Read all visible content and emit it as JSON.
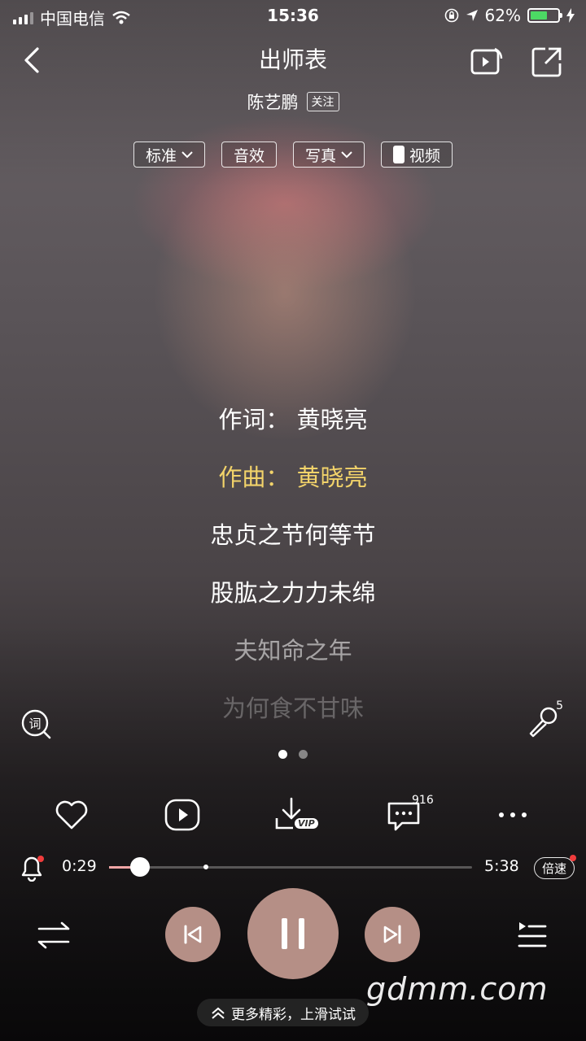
{
  "status_bar": {
    "carrier": "中国电信",
    "time": "15:36",
    "battery_text": "62%",
    "battery_level": 0.62
  },
  "header": {
    "title": "出师表",
    "artist": "陈艺鹏",
    "follow_label": "关注"
  },
  "chips": [
    {
      "label": "标准",
      "has_arrow": true
    },
    {
      "label": "音效",
      "has_arrow": false
    },
    {
      "label": "写真",
      "has_arrow": true
    },
    {
      "label": "视频",
      "has_arrow": false
    }
  ],
  "lyrics": [
    {
      "text": "作词： 黄晓亮",
      "style": "white"
    },
    {
      "text": "作曲： 黄晓亮",
      "style": "gold"
    },
    {
      "text": "忠贞之节何等节",
      "style": "white"
    },
    {
      "text": "股肱之力力未绵",
      "style": "white"
    },
    {
      "text": "夫知命之年",
      "style": "dim"
    },
    {
      "text": "为何食不甘味",
      "style": "dimmer"
    }
  ],
  "mic_count": "5",
  "actions": {
    "comment_count": "916",
    "download_badge": "VIP"
  },
  "player": {
    "current_time": "0:29",
    "total_time": "5:38",
    "progress": 0.086,
    "buffered": 0.26,
    "speed_label": "倍速"
  },
  "watermark": "gdmm.com",
  "bottom_hint": "更多精彩，上滑试试",
  "colors": {
    "accent_gold": "#f2d36a",
    "control_bg": "#b58f86",
    "progress_played": "#f0a6a6",
    "notify_red": "#f03c3c"
  }
}
